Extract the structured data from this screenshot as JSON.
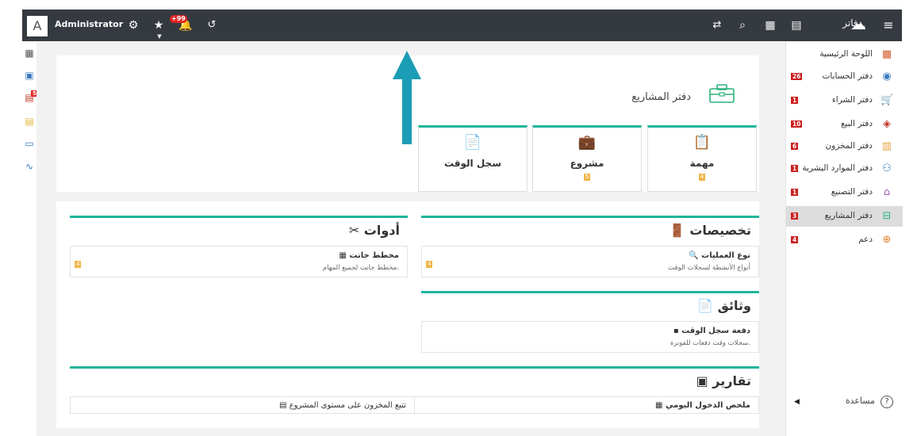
{
  "topbar": {
    "avatar_letter": "A",
    "username": "Administrator",
    "notifications_badge": "+99",
    "brand": "دفاتر"
  },
  "left_strip": {
    "badge": "54"
  },
  "sidebar": {
    "items": [
      {
        "label": "اللوحة الرئيسية",
        "badge": "",
        "icon": "dashboard-icon"
      },
      {
        "label": "دفتر الحسابات",
        "badge": "26",
        "icon": "coins-icon"
      },
      {
        "label": "دفتر الشراء",
        "badge": "1",
        "icon": "cart-icon"
      },
      {
        "label": "دفتر البيع",
        "badge": "10",
        "icon": "tag-icon"
      },
      {
        "label": "دفتر المخزون",
        "badge": "6",
        "icon": "warehouse-icon"
      },
      {
        "label": "دفتر الموارد البشرية",
        "badge": "1",
        "icon": "people-icon"
      },
      {
        "label": "دفتر التصنيع",
        "badge": "1",
        "icon": "factory-icon"
      },
      {
        "label": "دفتر المشاريع",
        "badge": "3",
        "icon": "briefcase-icon"
      },
      {
        "label": "دعم",
        "badge": "4",
        "icon": "lifebuoy-icon"
      }
    ],
    "help_label": "مساعدة"
  },
  "main": {
    "title": "دفتر المشاريع",
    "cards": [
      {
        "label": "مهمة",
        "badge": "4"
      },
      {
        "label": "مشروع",
        "badge": "5"
      },
      {
        "label": "سجل الوقت",
        "badge": ""
      }
    ],
    "sections": {
      "allocations": {
        "title": "تخصيصات",
        "item_title": "نوع العمليات",
        "item_desc": "أنواع الأنشطة لسجلات الوقت",
        "badge": "4"
      },
      "tools": {
        "title": "أدوات",
        "item_title": "مخطط جانت",
        "item_desc": "مخطط جانت لجميع المهام.",
        "badge": "4"
      },
      "documents": {
        "title": "وثائق",
        "item_title": "دفعة سجل الوقت",
        "item_desc": "سجلات وقت دفعات للفوترة."
      },
      "reports": {
        "title": "تقارير",
        "item1": "ملخص الدخول اليومي",
        "item2": "تتبع المخزون على مستوى المشروع"
      }
    }
  }
}
